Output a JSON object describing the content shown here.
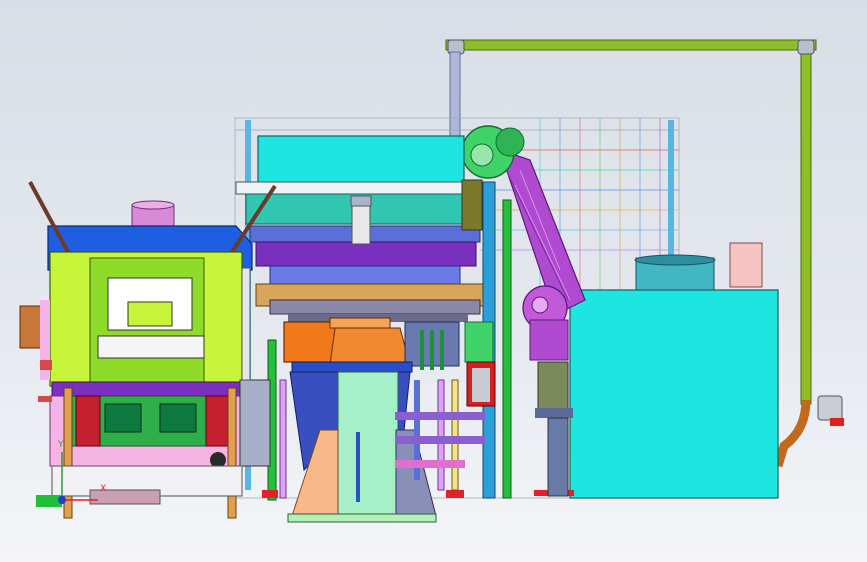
{
  "scene": {
    "description_free": true,
    "background": {
      "top": "#d9dee6",
      "bottom": "#f4f5f8"
    },
    "colors": {
      "pipe": "#8fbe2b",
      "cyan": "#1de5e0",
      "teal": "#3cc7bf",
      "blue": "#1d5fe0",
      "purple": "#7b2fbf",
      "magenta": "#d12fd1",
      "lime": "#c6f53a",
      "orange": "#f07a1a",
      "green": "#1fbf3a",
      "red": "#d42020",
      "pink": "#f5b3e6",
      "peach": "#f7b98a"
    }
  },
  "triad": {
    "x_label": "X",
    "y_label": "Y"
  }
}
